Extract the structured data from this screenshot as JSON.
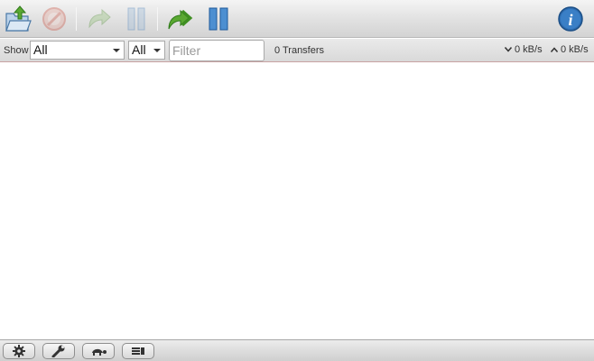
{
  "toolbar": {
    "buttons": [
      {
        "icon": "open-torrent-icon",
        "enabled": true
      },
      {
        "icon": "remove-icon",
        "enabled": false
      },
      {
        "icon": "start-icon",
        "enabled": false
      },
      {
        "icon": "pause-icon",
        "enabled": false
      },
      {
        "icon": "start-all-icon",
        "enabled": true
      },
      {
        "icon": "pause-all-icon",
        "enabled": true
      },
      {
        "icon": "info-icon",
        "enabled": true
      }
    ]
  },
  "filterbar": {
    "show_label": "Show",
    "state_select": "All",
    "tracker_select": "All",
    "filter_placeholder": "Filter",
    "filter_value": "",
    "transfers_count": "0 Transfers",
    "download_speed": "0 kB/s",
    "upload_speed": "0 kB/s"
  },
  "footer": {
    "buttons": [
      {
        "icon": "settings-gear-icon"
      },
      {
        "icon": "preferences-wrench-icon"
      },
      {
        "icon": "turtle-speed-icon"
      },
      {
        "icon": "compact-view-icon"
      }
    ]
  },
  "colors": {
    "accent_green": "#5aa832",
    "accent_blue": "#2f6fb4",
    "disabled_red": "#c94b3a"
  }
}
